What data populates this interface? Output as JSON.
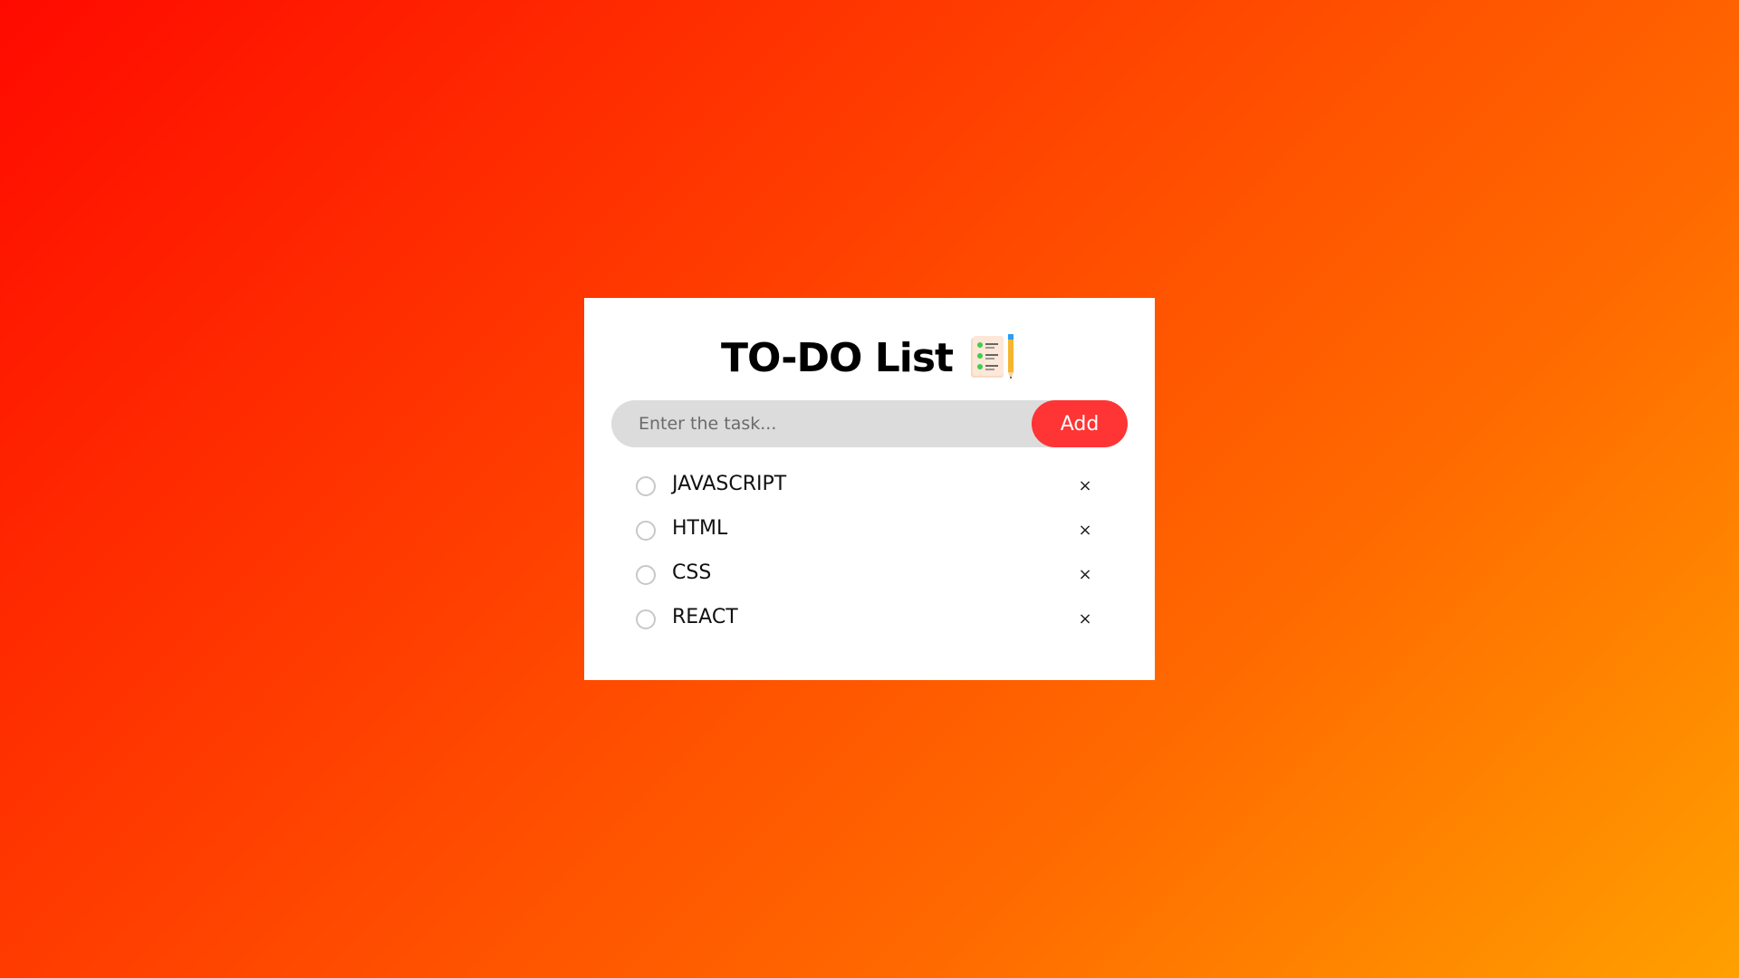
{
  "app": {
    "title": "TO-DO List",
    "title_icon": "checklist-notepad-pencil-icon"
  },
  "input": {
    "placeholder": "Enter the task...",
    "value": "",
    "add_label": "Add"
  },
  "colors": {
    "background_start": "#ff0a00",
    "background_end": "#ffa000",
    "add_button": "#ff3434",
    "input_background": "#dcdcdc"
  },
  "tasks": [
    {
      "label": "JAVASCRIPT",
      "checked": false,
      "remove_label": "×"
    },
    {
      "label": "HTML",
      "checked": false,
      "remove_label": "×"
    },
    {
      "label": "CSS",
      "checked": false,
      "remove_label": "×"
    },
    {
      "label": "REACT",
      "checked": false,
      "remove_label": "×"
    }
  ]
}
